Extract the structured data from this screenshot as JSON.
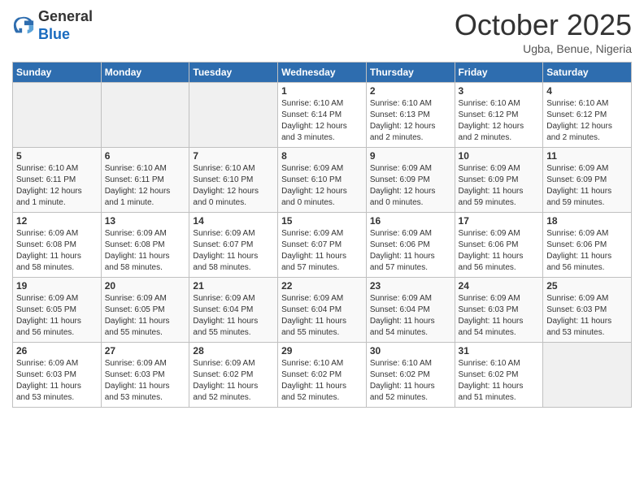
{
  "header": {
    "logo_line1": "General",
    "logo_line2": "Blue",
    "month": "October 2025",
    "location": "Ugba, Benue, Nigeria"
  },
  "weekdays": [
    "Sunday",
    "Monday",
    "Tuesday",
    "Wednesday",
    "Thursday",
    "Friday",
    "Saturday"
  ],
  "weeks": [
    [
      {
        "day": "",
        "info": ""
      },
      {
        "day": "",
        "info": ""
      },
      {
        "day": "",
        "info": ""
      },
      {
        "day": "1",
        "info": "Sunrise: 6:10 AM\nSunset: 6:14 PM\nDaylight: 12 hours\nand 3 minutes."
      },
      {
        "day": "2",
        "info": "Sunrise: 6:10 AM\nSunset: 6:13 PM\nDaylight: 12 hours\nand 2 minutes."
      },
      {
        "day": "3",
        "info": "Sunrise: 6:10 AM\nSunset: 6:12 PM\nDaylight: 12 hours\nand 2 minutes."
      },
      {
        "day": "4",
        "info": "Sunrise: 6:10 AM\nSunset: 6:12 PM\nDaylight: 12 hours\nand 2 minutes."
      }
    ],
    [
      {
        "day": "5",
        "info": "Sunrise: 6:10 AM\nSunset: 6:11 PM\nDaylight: 12 hours\nand 1 minute."
      },
      {
        "day": "6",
        "info": "Sunrise: 6:10 AM\nSunset: 6:11 PM\nDaylight: 12 hours\nand 1 minute."
      },
      {
        "day": "7",
        "info": "Sunrise: 6:10 AM\nSunset: 6:10 PM\nDaylight: 12 hours\nand 0 minutes."
      },
      {
        "day": "8",
        "info": "Sunrise: 6:09 AM\nSunset: 6:10 PM\nDaylight: 12 hours\nand 0 minutes."
      },
      {
        "day": "9",
        "info": "Sunrise: 6:09 AM\nSunset: 6:09 PM\nDaylight: 12 hours\nand 0 minutes."
      },
      {
        "day": "10",
        "info": "Sunrise: 6:09 AM\nSunset: 6:09 PM\nDaylight: 11 hours\nand 59 minutes."
      },
      {
        "day": "11",
        "info": "Sunrise: 6:09 AM\nSunset: 6:09 PM\nDaylight: 11 hours\nand 59 minutes."
      }
    ],
    [
      {
        "day": "12",
        "info": "Sunrise: 6:09 AM\nSunset: 6:08 PM\nDaylight: 11 hours\nand 58 minutes."
      },
      {
        "day": "13",
        "info": "Sunrise: 6:09 AM\nSunset: 6:08 PM\nDaylight: 11 hours\nand 58 minutes."
      },
      {
        "day": "14",
        "info": "Sunrise: 6:09 AM\nSunset: 6:07 PM\nDaylight: 11 hours\nand 58 minutes."
      },
      {
        "day": "15",
        "info": "Sunrise: 6:09 AM\nSunset: 6:07 PM\nDaylight: 11 hours\nand 57 minutes."
      },
      {
        "day": "16",
        "info": "Sunrise: 6:09 AM\nSunset: 6:06 PM\nDaylight: 11 hours\nand 57 minutes."
      },
      {
        "day": "17",
        "info": "Sunrise: 6:09 AM\nSunset: 6:06 PM\nDaylight: 11 hours\nand 56 minutes."
      },
      {
        "day": "18",
        "info": "Sunrise: 6:09 AM\nSunset: 6:06 PM\nDaylight: 11 hours\nand 56 minutes."
      }
    ],
    [
      {
        "day": "19",
        "info": "Sunrise: 6:09 AM\nSunset: 6:05 PM\nDaylight: 11 hours\nand 56 minutes."
      },
      {
        "day": "20",
        "info": "Sunrise: 6:09 AM\nSunset: 6:05 PM\nDaylight: 11 hours\nand 55 minutes."
      },
      {
        "day": "21",
        "info": "Sunrise: 6:09 AM\nSunset: 6:04 PM\nDaylight: 11 hours\nand 55 minutes."
      },
      {
        "day": "22",
        "info": "Sunrise: 6:09 AM\nSunset: 6:04 PM\nDaylight: 11 hours\nand 55 minutes."
      },
      {
        "day": "23",
        "info": "Sunrise: 6:09 AM\nSunset: 6:04 PM\nDaylight: 11 hours\nand 54 minutes."
      },
      {
        "day": "24",
        "info": "Sunrise: 6:09 AM\nSunset: 6:03 PM\nDaylight: 11 hours\nand 54 minutes."
      },
      {
        "day": "25",
        "info": "Sunrise: 6:09 AM\nSunset: 6:03 PM\nDaylight: 11 hours\nand 53 minutes."
      }
    ],
    [
      {
        "day": "26",
        "info": "Sunrise: 6:09 AM\nSunset: 6:03 PM\nDaylight: 11 hours\nand 53 minutes."
      },
      {
        "day": "27",
        "info": "Sunrise: 6:09 AM\nSunset: 6:03 PM\nDaylight: 11 hours\nand 53 minutes."
      },
      {
        "day": "28",
        "info": "Sunrise: 6:09 AM\nSunset: 6:02 PM\nDaylight: 11 hours\nand 52 minutes."
      },
      {
        "day": "29",
        "info": "Sunrise: 6:10 AM\nSunset: 6:02 PM\nDaylight: 11 hours\nand 52 minutes."
      },
      {
        "day": "30",
        "info": "Sunrise: 6:10 AM\nSunset: 6:02 PM\nDaylight: 11 hours\nand 52 minutes."
      },
      {
        "day": "31",
        "info": "Sunrise: 6:10 AM\nSunset: 6:02 PM\nDaylight: 11 hours\nand 51 minutes."
      },
      {
        "day": "",
        "info": ""
      }
    ]
  ]
}
